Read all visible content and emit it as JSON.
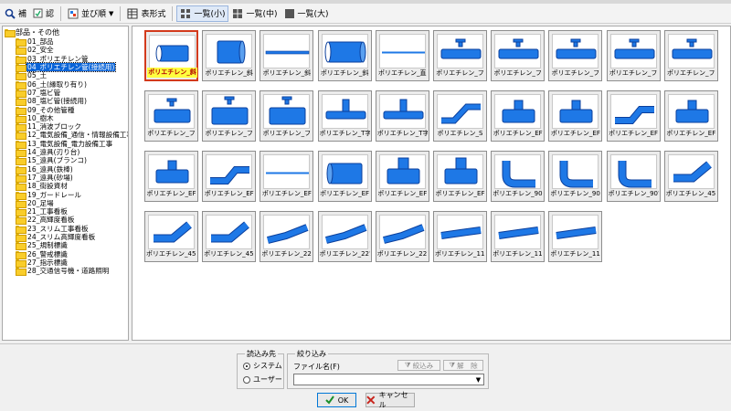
{
  "toolbar": {
    "btn1": "補",
    "btn2": "認",
    "sort": "並び順",
    "table": "表形式",
    "list_small": "一覧(小)",
    "list_medium": "一覧(中)",
    "list_large": "一覧(大)"
  },
  "tree": {
    "root": "部品・その他",
    "items": [
      "01_部品",
      "02_安全",
      "03_ポリエチレン管",
      "04_ポリエチレン管(接続用)",
      "05_土",
      "06_土(縁取り有り)",
      "07_塩ビ管",
      "08_塩ビ管(接続用)",
      "09_その他管種",
      "10_樹木",
      "11_消波ブロック",
      "12_電気設備_通信・情報設備工事",
      "13_電気設備_電力設備工事",
      "14_遠具(刃り台)",
      "15_遠具(ブランコ)",
      "16_遠具(鉄棒)",
      "17_遠具(砂場)",
      "18_街設資材",
      "19_ガードレール",
      "20_足場",
      "21_工事看板",
      "22_高輝度看板",
      "23_スリム工事看板",
      "24_スリム高輝度看板",
      "25_規制標識",
      "26_警戒標識",
      "27_指示標識",
      "28_交通信号機・道路照明"
    ],
    "selected_index": 3
  },
  "tiles": [
    {
      "icon": "pipe-stub",
      "caption": "ポリエチレン_斜"
    },
    {
      "icon": "pipe-socket",
      "caption": "ポリエチレン_斜"
    },
    {
      "icon": "pipe-line",
      "caption": "ポリエチレン_斜"
    },
    {
      "icon": "pipe-straight",
      "caption": "ポリエチレン_斜"
    },
    {
      "icon": "pipe-line-thin",
      "caption": "ポリエチレン_直"
    },
    {
      "icon": "pipe-tee-flange",
      "caption": "ポリエチレン_フ"
    },
    {
      "icon": "pipe-tee-flange",
      "caption": "ポリエチレン_フ"
    },
    {
      "icon": "pipe-tee-flange",
      "caption": "ポリエチレン_フ"
    },
    {
      "icon": "pipe-tee-flange",
      "caption": "ポリエチレン_フ"
    },
    {
      "icon": "pipe-tee-flange",
      "caption": "ポリエチレン_フ"
    },
    {
      "icon": "pipe-tee-valve",
      "caption": "ポリエチレン_フ"
    },
    {
      "icon": "pipe-tee-valve-big",
      "caption": "ポリエチレン_フ"
    },
    {
      "icon": "pipe-tee-valve-big",
      "caption": "ポリエチレン_フ"
    },
    {
      "icon": "pipe-tee",
      "caption": "ポリエチレン_T字"
    },
    {
      "icon": "pipe-tee",
      "caption": "ポリエチレン_T字"
    },
    {
      "icon": "pipe-s-bend",
      "caption": "ポリエチレン_S"
    },
    {
      "icon": "pipe-ef-tee",
      "caption": "ポリエチレン_EF"
    },
    {
      "icon": "pipe-ef-tee",
      "caption": "ポリエチレン_EF"
    },
    {
      "icon": "pipe-offset",
      "caption": "ポリエチレン_EF"
    },
    {
      "icon": "pipe-ef-tee",
      "caption": "ポリエチレン_EF"
    },
    {
      "icon": "pipe-ef-tee",
      "caption": "ポリエチレン_EF"
    },
    {
      "icon": "pipe-offset",
      "caption": "ポリエチレン_EF"
    },
    {
      "icon": "pipe-line-thin",
      "caption": "ポリエチレン_EF"
    },
    {
      "icon": "pipe-drum",
      "caption": "ポリエチレン_EF"
    },
    {
      "icon": "pipe-reducer-tee",
      "caption": "ポリエチレン_EF"
    },
    {
      "icon": "pipe-reducer-tee",
      "caption": "ポリエチレン_EF"
    },
    {
      "icon": "pipe-elbow-90",
      "caption": "ポリエチレン_90°"
    },
    {
      "icon": "pipe-elbow-90",
      "caption": "ポリエチレン_90°"
    },
    {
      "icon": "pipe-elbow-90",
      "caption": "ポリエチレン_90°"
    },
    {
      "icon": "pipe-elbow-45",
      "caption": "ポリエチレン_45°"
    },
    {
      "icon": "pipe-elbow-45",
      "caption": "ポリエチレン_45°"
    },
    {
      "icon": "pipe-elbow-45",
      "caption": "ポリエチレン_45°"
    },
    {
      "icon": "pipe-bend-22",
      "caption": "ポリエチレン_22°"
    },
    {
      "icon": "pipe-bend-22",
      "caption": "ポリエチレン_22°"
    },
    {
      "icon": "pipe-bend-22",
      "caption": "ポリエチレン_22°"
    },
    {
      "icon": "pipe-bend-11",
      "caption": "ポリエチレン_11°"
    },
    {
      "icon": "pipe-bend-11",
      "caption": "ポリエチレン_11°"
    },
    {
      "icon": "pipe-bend-11",
      "caption": "ポリエチレン_11°"
    }
  ],
  "selected_tile": 0,
  "load_from": {
    "legend": "読込み先",
    "system": "システム",
    "user": "ユーザー",
    "selected": "system"
  },
  "filter": {
    "legend": "絞り込み",
    "filename_label": "ファイル名(F)",
    "filter_btn": "絞込み",
    "clear_btn": "解　除",
    "combo_value": ""
  },
  "buttons": {
    "ok": "OK",
    "cancel": "キャンセル"
  },
  "colors": {
    "pipe": "#1e78e6",
    "pipe_dark": "#0b3f9c",
    "selection": "#0a64d8",
    "ok": "#1a8f2a",
    "cancel": "#c8241c"
  }
}
